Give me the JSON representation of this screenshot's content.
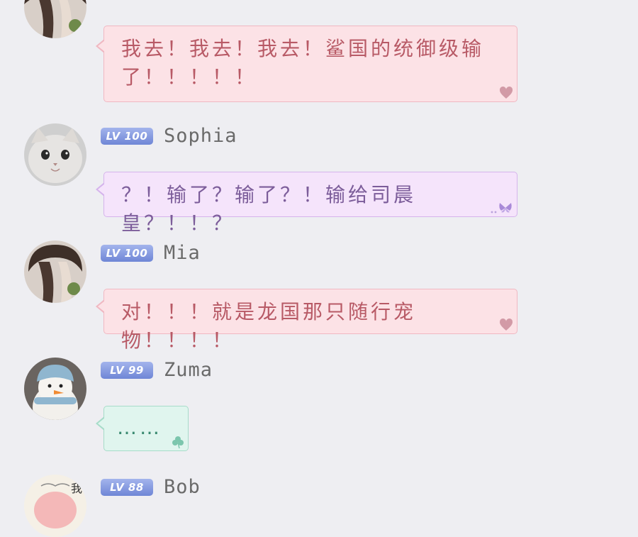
{
  "messages": [
    {
      "avatar": "girl-hair-avatar",
      "text": "我去！我去！我去！鲨国的统御级输了！！！！！",
      "bubble_theme": "pink",
      "bubble_icon": "heart-icon"
    },
    {
      "level": "LV 100",
      "user": "Sophia",
      "avatar": "cat-avatar",
      "text": "？！输了？输了？！输给司晨皇？！！？",
      "bubble_theme": "purple",
      "bubble_icon": "butterfly-icon"
    },
    {
      "level": "LV 100",
      "user": "Mia",
      "avatar": "girl-hair-avatar",
      "text": "对！！！就是龙国那只随行宠物！！！！",
      "bubble_theme": "pink",
      "bubble_icon": "heart-icon"
    },
    {
      "level": "LV 99",
      "user": "Zuma",
      "avatar": "snowman-avatar",
      "text": "……",
      "bubble_theme": "mint",
      "bubble_icon": "clover-icon"
    },
    {
      "level": "LV 88",
      "user": "Bob",
      "avatar": "pig-avatar",
      "avatar_char": "我"
    }
  ],
  "colors": {
    "background": "#eeeef2",
    "badge_top": "#a3b4ec",
    "badge_bottom": "#6f86d6",
    "pink_bubble": "#fce2e6",
    "purple_bubble": "#f5e4fb",
    "mint_bubble": "#e0f5ee"
  }
}
